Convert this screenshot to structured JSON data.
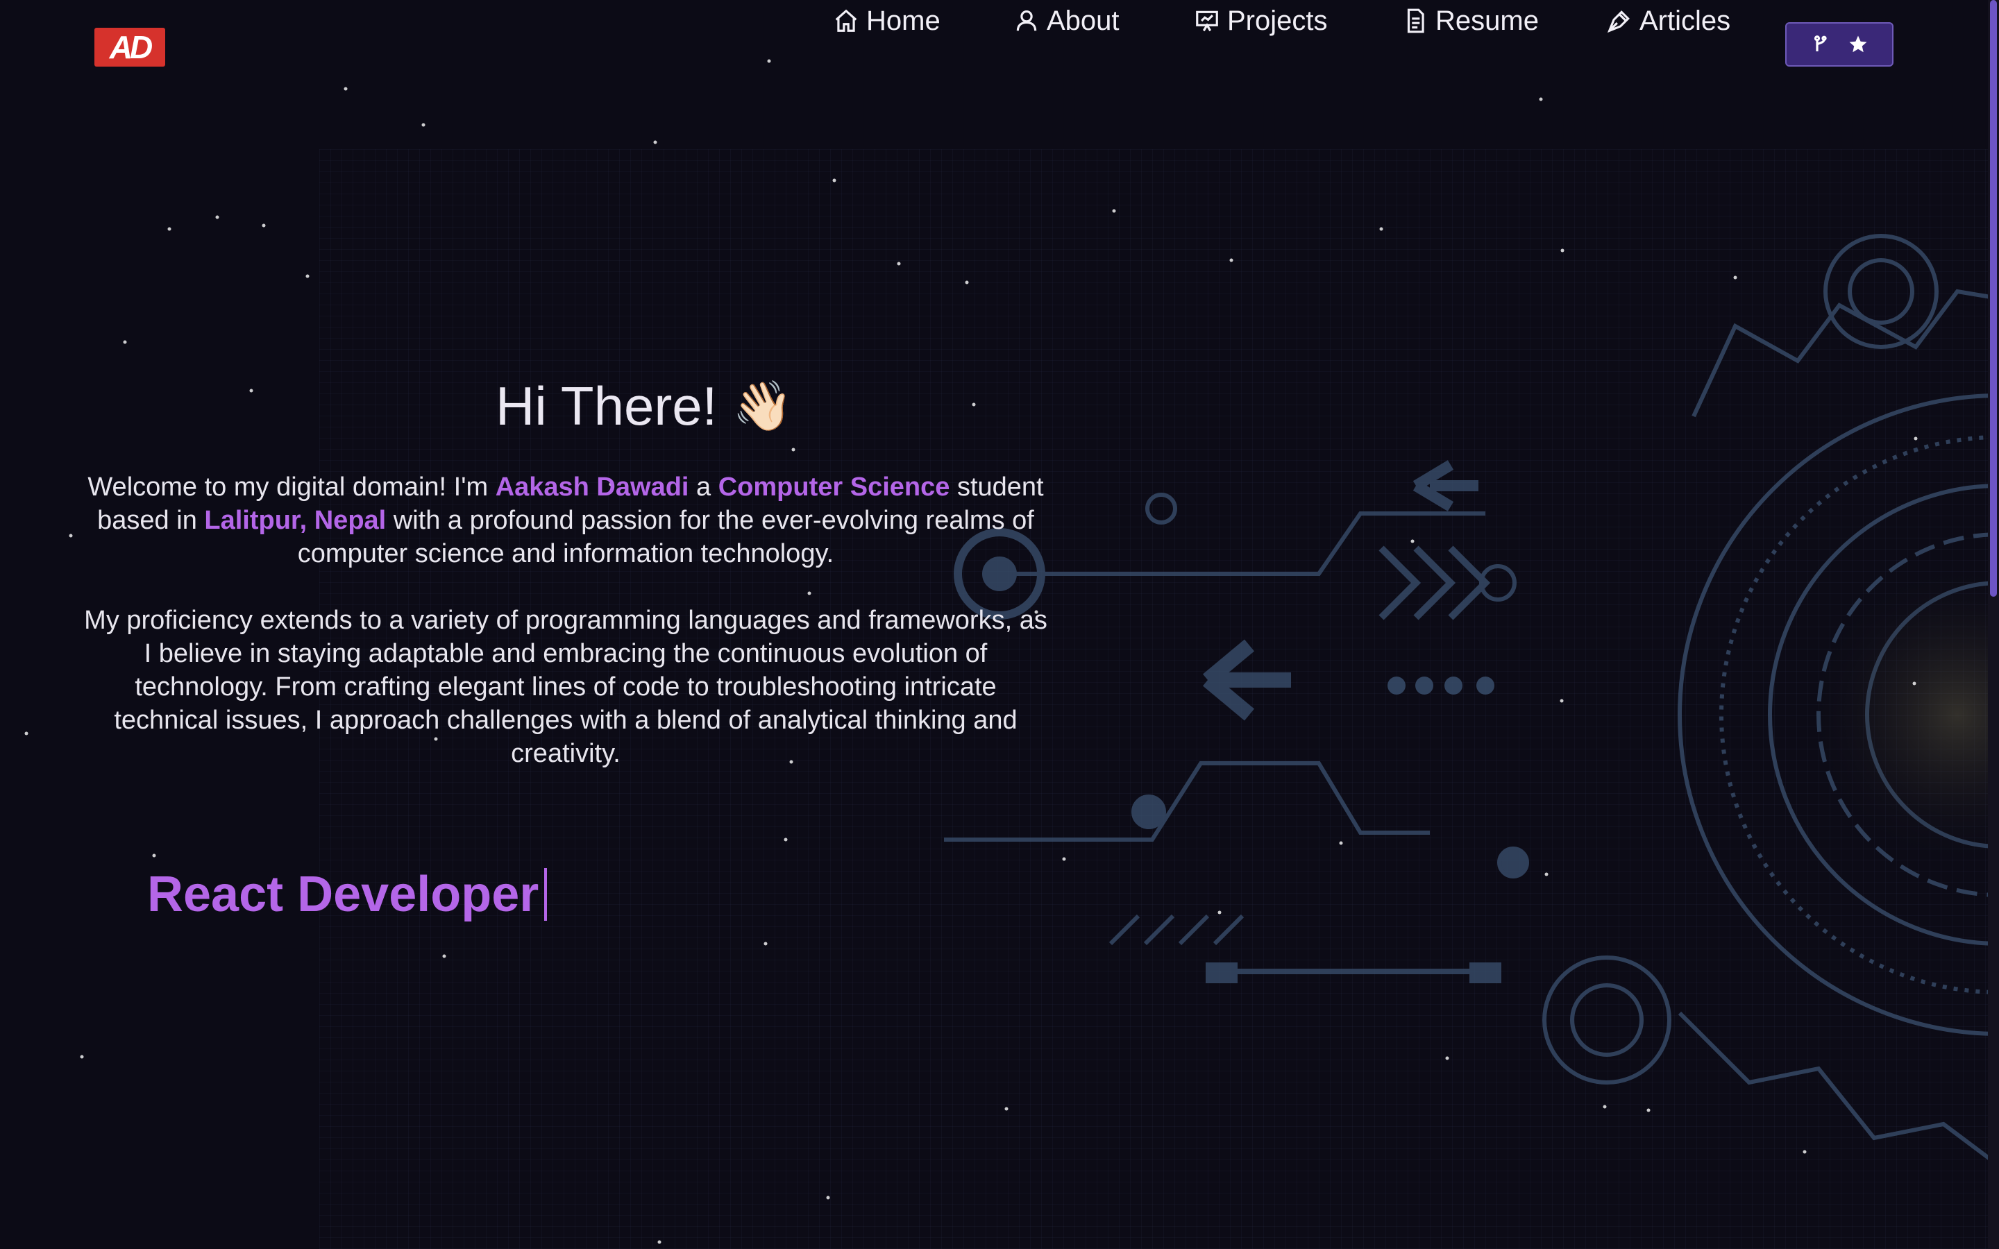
{
  "brand": {
    "logo_text": "AD"
  },
  "nav": {
    "items": [
      {
        "label": "Home",
        "icon": "home-icon"
      },
      {
        "label": "About",
        "icon": "user-icon"
      },
      {
        "label": "Projects",
        "icon": "presentation-icon"
      },
      {
        "label": "Resume",
        "icon": "document-icon"
      },
      {
        "label": "Articles",
        "icon": "pen-icon"
      }
    ],
    "github_button": {
      "icons": [
        "git-fork-icon",
        "star-icon"
      ]
    }
  },
  "hero": {
    "greeting": "Hi There!",
    "wave_emoji": "👋🏻",
    "intro_p1": {
      "t1": "Welcome to my digital domain! I'm ",
      "name": "Aakash Dawadi",
      "t2": " a ",
      "field": "Computer Science",
      "t3": " student based in ",
      "location": "Lalitpur, Nepal",
      "t4": " with a profound passion for the ever-evolving realms of computer science and information technology."
    },
    "intro_p2": "My proficiency extends to a variety of programming languages and frameworks, as I believe in staying adaptable and embracing the continuous evolution of technology. From crafting elegant lines of code to troubleshooting intricate technical issues, I approach challenges with a blend of analytical thinking and creativity.",
    "typing_text": "React Developer"
  },
  "colors": {
    "background": "#0c0b16",
    "accent": "#b466e8",
    "logo_red": "#d6322c",
    "button_purple": "#3a2878"
  }
}
